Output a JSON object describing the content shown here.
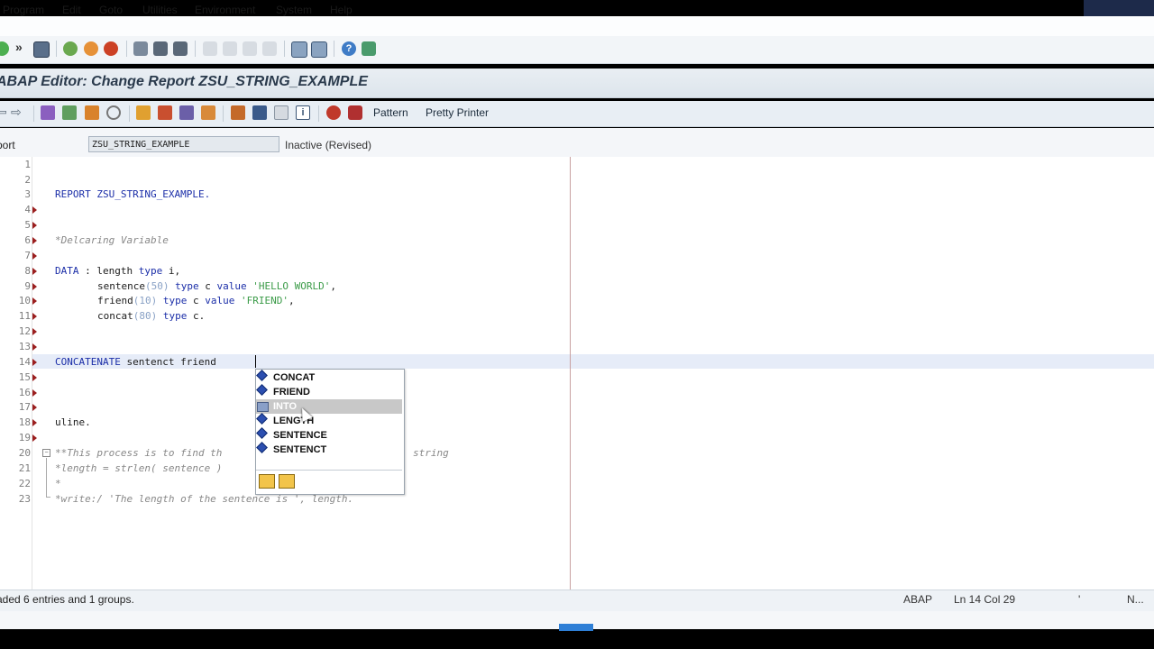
{
  "menu": {
    "program": "Program",
    "edit": "Edit",
    "goto": "Goto",
    "utilities": "Utilities",
    "environment": "Environment",
    "system": "System",
    "help": "Help"
  },
  "toolbar": {
    "icons": [
      "enter-icon",
      "more-icon",
      "save-icon",
      "back-icon",
      "exit-icon",
      "cancel-icon",
      "print-icon",
      "find-icon",
      "find-next-icon",
      "first-page-icon",
      "prev-page-icon",
      "next-page-icon",
      "last-page-icon",
      "new-session-icon",
      "shortcut-icon",
      "help-icon",
      "customize-icon"
    ]
  },
  "title": "ABAP Editor: Change Report ZSU_STRING_EXAMPLE",
  "app_toolbar": {
    "pattern": "Pattern",
    "pretty_printer": "Pretty Printer"
  },
  "field": {
    "label": "port",
    "value": "ZSU_STRING_EXAMPLE",
    "status": "Inactive (Revised)"
  },
  "editor": {
    "line_numbers": [
      "1",
      "2",
      "3",
      "4",
      "5",
      "6",
      "7",
      "8",
      "9",
      "10",
      "11",
      "12",
      "13",
      "14",
      "15",
      "16",
      "17",
      "18",
      "19",
      "20",
      "21",
      "22",
      "23"
    ],
    "line3": "REPORT ZSU_STRING_EXAMPLE.",
    "line6": "*Delcaring Variable",
    "line8_kw": "DATA",
    "line8_rest": " : length ",
    "line8_kw2": "type",
    "line8_end": " i,",
    "line9_a": "sentence",
    "line9_num": "(50)",
    "line9_kw": " type",
    "line9_b": " c ",
    "line9_kw2": "value",
    "line9_str": " 'HELLO WORLD'",
    "line9_end": ",",
    "line10_a": "friend",
    "line10_num": "(10)",
    "line10_kw": " type",
    "line10_b": " c ",
    "line10_kw2": "value",
    "line10_str": " 'FRIEND'",
    "line10_end": ",",
    "line11_a": "concat",
    "line11_num": "(80)",
    "line11_kw": " type",
    "line11_end": " c.",
    "line14_kw": "CONCATENATE",
    "line14_rest": " sentenct friend ",
    "line18": "uline.",
    "line20a": "**This process is to find th",
    "line20b": "string",
    "line21": "*length = strlen( sentence )",
    "line22": "*",
    "line23": "*write:/ 'The length of the sentence is ', length."
  },
  "autocomplete": {
    "items": [
      "CONCAT",
      "FRIEND",
      "INTO",
      "LENGTH",
      "SENTENCE",
      "SENTENCT"
    ],
    "selected": "INTO"
  },
  "status": {
    "message": "aded 6 entries and 1 groups.",
    "language": "ABAP",
    "position": "Ln  14 Col  29",
    "mode": "N..."
  }
}
